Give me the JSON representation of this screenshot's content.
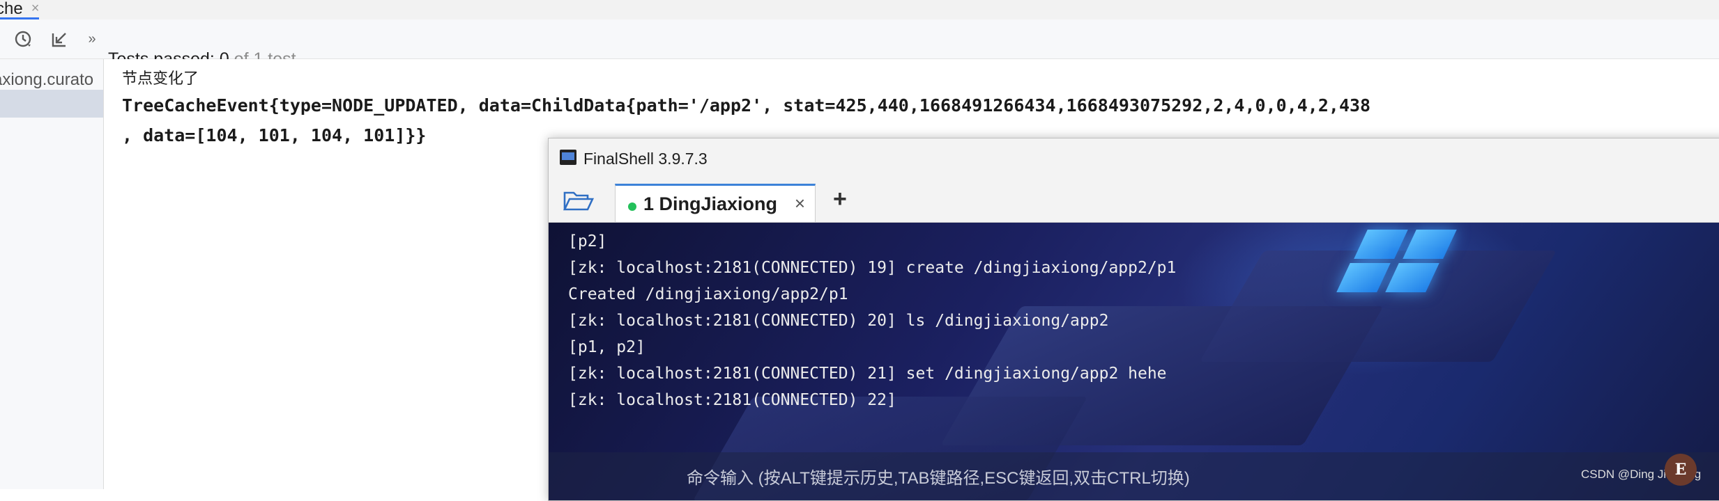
{
  "ide": {
    "tab_label": "che",
    "tab_close": "×",
    "toolbar": {
      "status_prefix": "Tests passed: ",
      "status_count": "0",
      "status_suffix": " of 1 test",
      "more": "»"
    },
    "tree": {
      "item_label": "axiong.curato"
    },
    "console": {
      "line1": "节点变化了",
      "line2": "TreeCacheEvent{type=NODE_UPDATED, data=ChildData{path='/app2', stat=425,440,1668491266434,1668493075292,2,4,0,0,4,2,438",
      "line3": ", data=[104, 101, 104, 101]}}"
    }
  },
  "finalshell": {
    "title": "FinalShell 3.9.7.3",
    "tab_label": "1 DingJiaxiong",
    "tab_close": "×",
    "add_tab": "+",
    "status_color": "#23c05a",
    "terminal_lines": [
      "[p2]",
      "[zk: localhost:2181(CONNECTED) 19] create /dingjiaxiong/app2/p1",
      "Created /dingjiaxiong/app2/p1",
      "[zk: localhost:2181(CONNECTED) 20] ls /dingjiaxiong/app2",
      "[p1, p2]",
      "[zk: localhost:2181(CONNECTED) 21] set /dingjiaxiong/app2 hehe",
      "[zk: localhost:2181(CONNECTED) 22]"
    ],
    "command_hint": "命令输入 (按ALT键提示历史,TAB键路径,ESC键返回,双击CTRL切换)"
  },
  "overlay": {
    "watermark": "CSDN @Ding Jiaxiong",
    "avatar_letter": "E"
  }
}
